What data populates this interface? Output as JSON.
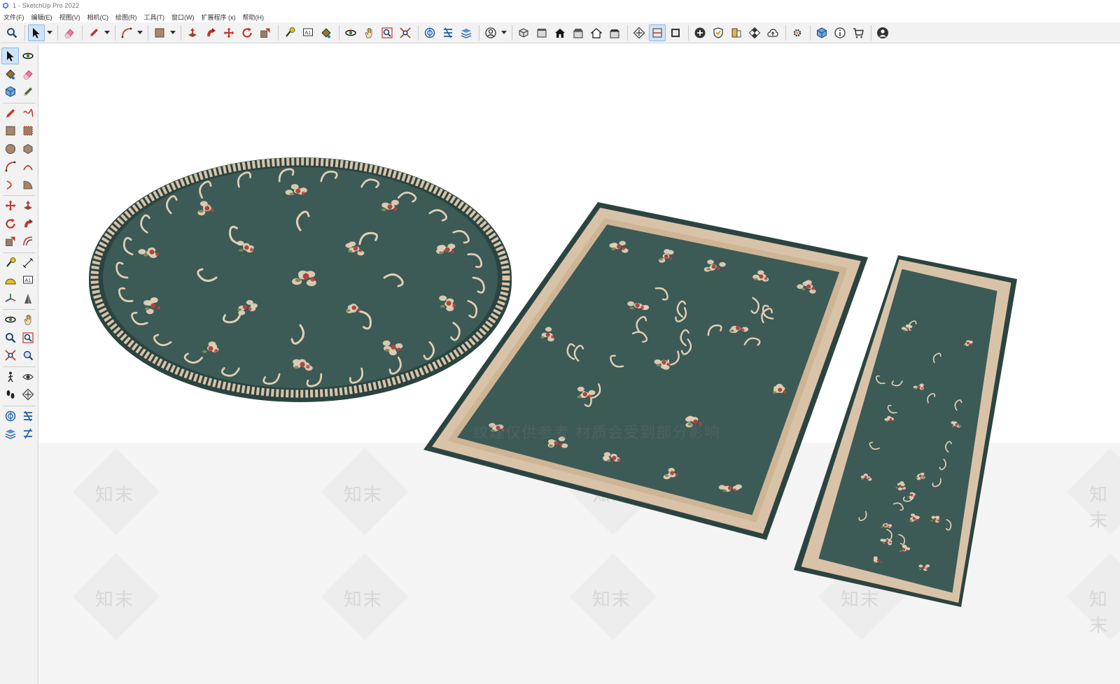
{
  "window": {
    "title": "1 - SketchUp Pro 2022"
  },
  "menubar": {
    "items": [
      "文件(F)",
      "编辑(E)",
      "视图(V)",
      "相机(C)",
      "绘图(R)",
      "工具(T)",
      "窗口(W)",
      "扩展程序 (x)",
      "帮助(H)"
    ]
  },
  "toolbar": {
    "groups": [
      [
        "zoom-icon"
      ],
      [
        "select-icon",
        "dropdown"
      ],
      [
        "eraser-icon"
      ],
      [
        "pencil-icon",
        "dropdown"
      ],
      [
        "arc-icon",
        "dropdown"
      ],
      [
        "rectangle-icon",
        "dropdown"
      ],
      [
        "push-pull-icon",
        "follow-me-icon",
        "move-icon",
        "rotate-icon",
        "scale-icon"
      ],
      [
        "tape-measure-icon",
        "text-icon",
        "paint-bucket-icon"
      ],
      [
        "orbit-icon",
        "pan-icon",
        "zoom-window-icon",
        "zoom-extents-icon"
      ],
      [
        "warehouse-icon",
        "extension-icon",
        "layers-icon"
      ],
      [
        "profile-icon",
        "dropdown"
      ],
      [
        "iso-view-icon",
        "top-view-icon",
        "front-view-icon",
        "right-view-icon",
        "back-view-icon",
        "left-view-icon"
      ],
      [
        "section-plane-icon",
        "display-section-icon",
        "section-fill-icon"
      ],
      [
        "add-location-icon",
        "shield-icon",
        "photo-texture-icon",
        "checker-icon",
        "cloud-icon"
      ],
      [
        "settings-icon"
      ],
      [
        "component-icon",
        "info-icon",
        "cart-icon"
      ],
      [
        "account-icon"
      ]
    ]
  },
  "left_toolbar": {
    "rows": [
      [
        "select-icon",
        "orbit-icon"
      ],
      [
        "paint-bucket-icon",
        "eraser-icon"
      ],
      [
        "component-icon",
        "pencil-edit-icon"
      ],
      "sep",
      [
        "line-icon",
        "freehand-icon"
      ],
      [
        "rectangle-icon",
        "rotated-rect-icon"
      ],
      [
        "circle-icon",
        "polygon-icon"
      ],
      [
        "arc-icon",
        "arc-2pt-icon"
      ],
      [
        "arc-3pt-icon",
        "pie-icon"
      ],
      "sep",
      [
        "move-icon",
        "push-pull-icon"
      ],
      [
        "rotate-icon",
        "follow-me-icon"
      ],
      [
        "scale-icon",
        "offset-icon"
      ],
      "sep",
      [
        "tape-measure-icon",
        "dimension-icon"
      ],
      [
        "protractor-icon",
        "text-icon"
      ],
      [
        "axes-icon",
        "3d-text-icon"
      ],
      "sep",
      [
        "orbit-icon",
        "pan-icon"
      ],
      [
        "zoom-icon",
        "zoom-window-icon"
      ],
      [
        "zoom-extents-icon",
        "position-camera-icon"
      ],
      "sep",
      [
        "walk-icon",
        "look-around-icon"
      ],
      [
        "footprint-icon",
        "section-plane-icon"
      ],
      "sep",
      [
        "warehouse-icon",
        "extension-icon"
      ],
      [
        "layers-icon",
        "extension-2-icon"
      ]
    ]
  },
  "watermarks": {
    "text": "知末",
    "overlay": "纹理仅供参考 材质会受到部分影响"
  },
  "scene": {
    "rugs": [
      {
        "name": "round-rug",
        "shape": "ellipse"
      },
      {
        "name": "rectangular-rug",
        "shape": "rectangle"
      },
      {
        "name": "runner-rug",
        "shape": "runner"
      }
    ],
    "colors": {
      "rug_field": "#3c5a56",
      "rug_dark": "#2b4441",
      "rug_border": "#d9c3a8",
      "rug_pattern": "#e2cfb4",
      "rose": "#b0453f",
      "leaf": "#7d8a55",
      "ground": "#f4f4f4"
    }
  }
}
